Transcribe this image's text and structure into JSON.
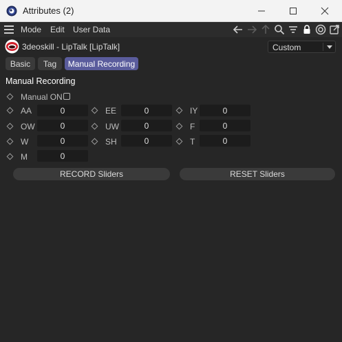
{
  "window": {
    "title": "Attributes (2)"
  },
  "menu": {
    "items": [
      "Mode",
      "Edit",
      "User Data"
    ]
  },
  "toolbar_icons": [
    "arrow-left-icon",
    "arrow-right-icon",
    "arrow-up-icon",
    "search-icon",
    "filter-icon",
    "lock-icon",
    "target-icon",
    "new-window-icon"
  ],
  "object": {
    "title": "3deoskill - LipTalk [LipTalk]",
    "preset": "Custom"
  },
  "tabs": [
    {
      "label": "Basic",
      "active": false
    },
    {
      "label": "Tag",
      "active": false
    },
    {
      "label": "Manual Recording",
      "active": true
    }
  ],
  "section": {
    "title": "Manual Recording",
    "manual_on_label": "Manual ON",
    "manual_on_checked": false
  },
  "params": [
    {
      "label": "AA",
      "value": "0"
    },
    {
      "label": "EE",
      "value": "0"
    },
    {
      "label": "IY",
      "value": "0"
    },
    {
      "label": "OW",
      "value": "0"
    },
    {
      "label": "UW",
      "value": "0"
    },
    {
      "label": "F",
      "value": "0"
    },
    {
      "label": "W",
      "value": "0"
    },
    {
      "label": "SH",
      "value": "0"
    },
    {
      "label": "T",
      "value": "0"
    },
    {
      "label": "M",
      "value": "0"
    }
  ],
  "buttons": {
    "record": "RECORD Sliders",
    "reset": "RESET Sliders"
  },
  "colors": {
    "background": "#262626",
    "active_tab": "#5a5c9c",
    "field": "#1c1c1c"
  }
}
